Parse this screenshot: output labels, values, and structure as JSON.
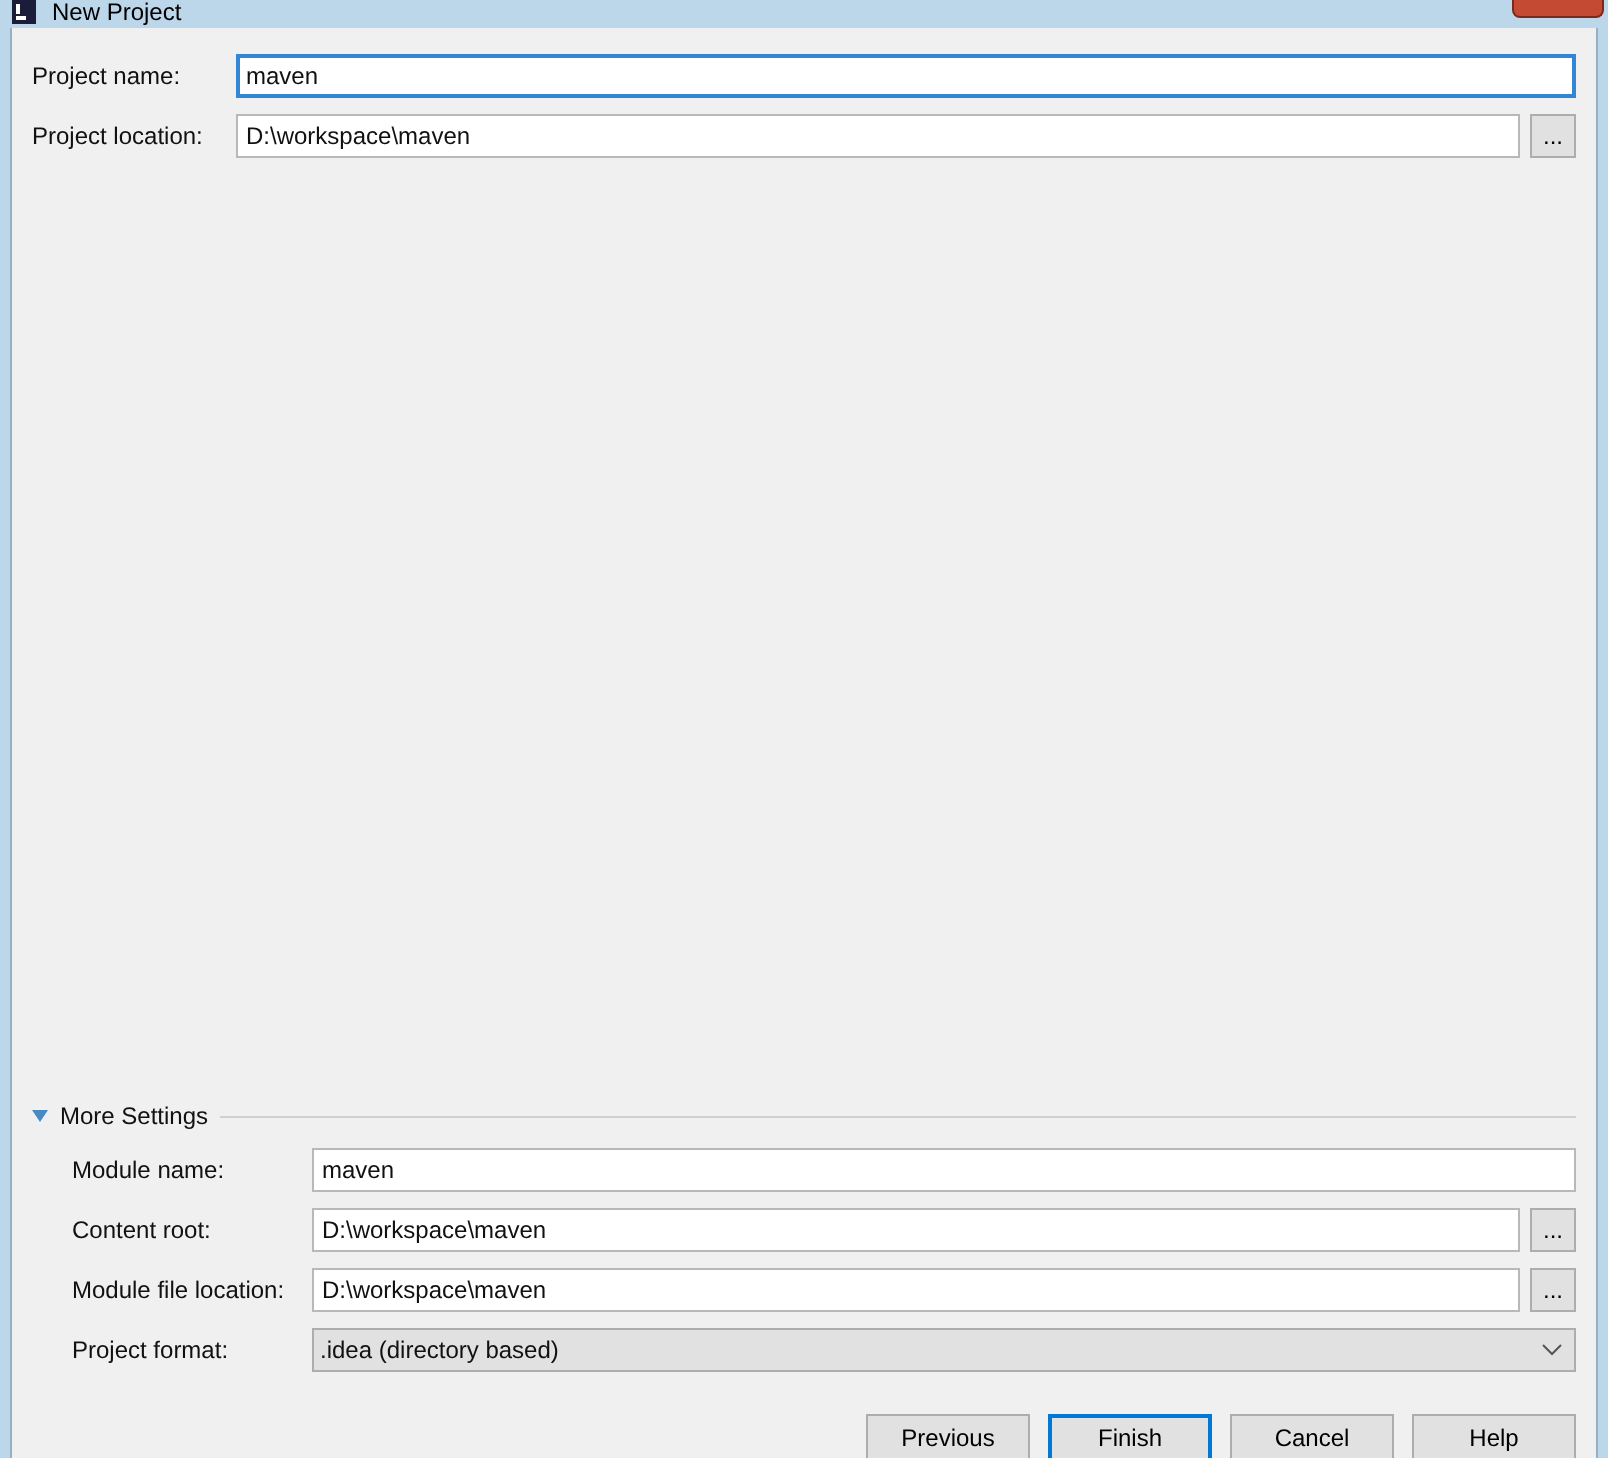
{
  "window": {
    "title": "New Project"
  },
  "project_fields": [
    {
      "label": "Project name:",
      "value": "maven",
      "focused": true
    },
    {
      "label": "Project location:",
      "value": "D:\\workspace\\maven",
      "focused": false,
      "browse_label": "..."
    }
  ],
  "more_settings": {
    "label": "More Settings",
    "expanded": true,
    "fields": [
      {
        "kind": "text",
        "label": "Module name:",
        "value": "maven"
      },
      {
        "kind": "text",
        "label": "Content root:",
        "value": "D:\\workspace\\maven",
        "browse_label": "..."
      },
      {
        "kind": "text",
        "label": "Module file location:",
        "value": "D:\\workspace\\maven",
        "browse_label": "..."
      },
      {
        "kind": "dropdown",
        "label": "Project format:",
        "value": ".idea (directory based)"
      }
    ]
  },
  "buttons": [
    {
      "label": "Previous",
      "default": false
    },
    {
      "label": "Finish",
      "default": true
    },
    {
      "label": "Cancel",
      "default": false
    },
    {
      "label": "Help",
      "default": false
    }
  ]
}
